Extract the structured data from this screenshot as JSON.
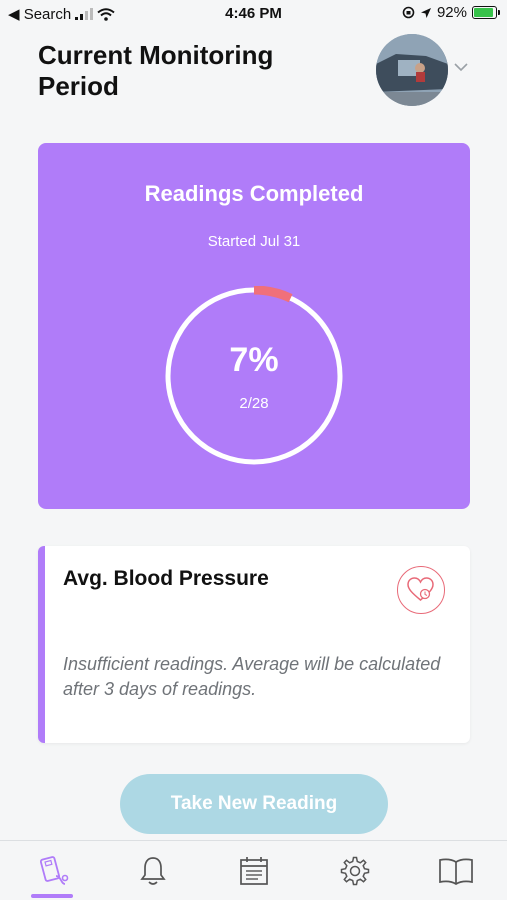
{
  "status_bar": {
    "back_label": "◀ Search",
    "time": "4:46 PM",
    "battery_percent": "92%",
    "battery_level": 0.92
  },
  "header": {
    "title": "Current Monitoring Period"
  },
  "readings_card": {
    "title": "Readings Completed",
    "subtitle": "Started Jul 31",
    "percent_label": "7%",
    "count_label": "2/28",
    "progress": 0.07,
    "colors": {
      "card": "#b07cf9",
      "progress": "#f0707a",
      "ring": "#ffffff"
    }
  },
  "bp_card": {
    "title": "Avg. Blood Pressure",
    "message": "Insufficient readings. Average will be calculated after 3 days of readings.",
    "icon": "heart-outline-icon",
    "accent_color": "#b07cf9"
  },
  "actions": {
    "take_reading_label": "Take New Reading",
    "button_color": "#add8e4"
  },
  "tab_bar": {
    "tabs": [
      "readings-icon",
      "bell-icon",
      "calendar-icon",
      "gear-icon",
      "book-icon"
    ],
    "active_index": 0,
    "active_color": "#b07cf9"
  }
}
